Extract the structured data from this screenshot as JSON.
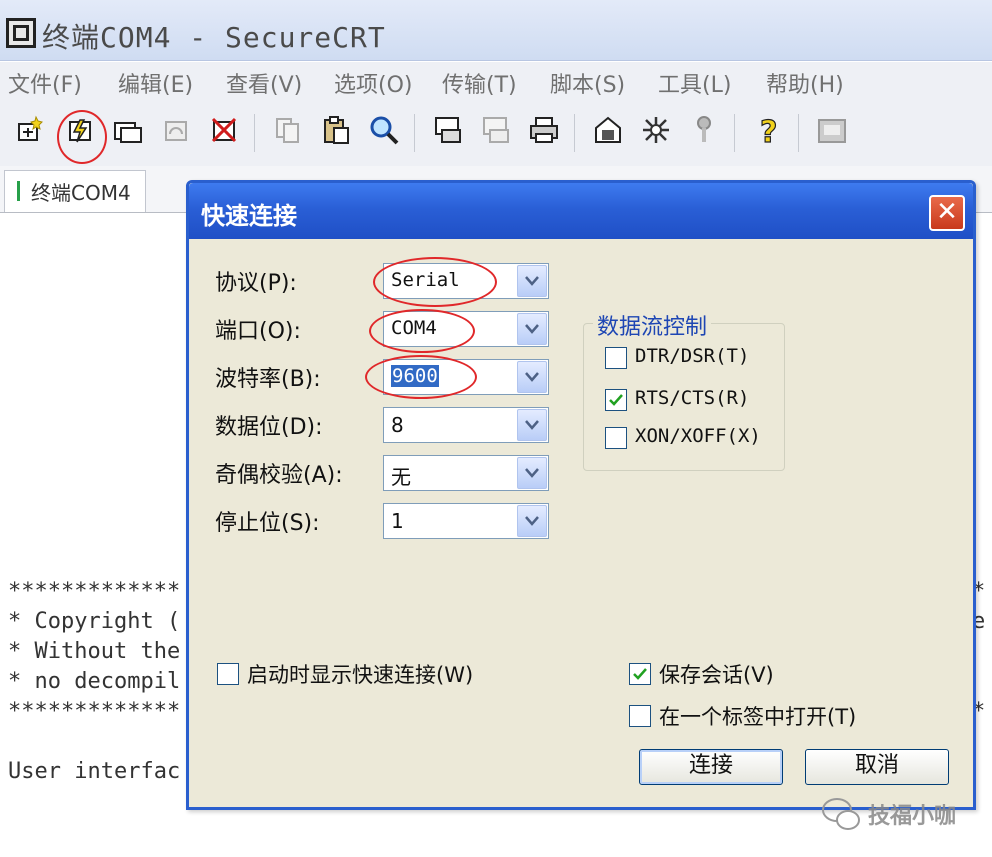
{
  "window": {
    "title": "终端COM4 - SecureCRT"
  },
  "menu": [
    {
      "label": "文件(F)"
    },
    {
      "label": "编辑(E)"
    },
    {
      "label": "查看(V)"
    },
    {
      "label": "选项(O)"
    },
    {
      "label": "传输(T)"
    },
    {
      "label": "脚本(S)"
    },
    {
      "label": "工具(L)"
    },
    {
      "label": "帮助(H)"
    }
  ],
  "toolbar": {
    "icons": [
      "connect-icon",
      "quick-connect-icon",
      "connect-in-tab-icon",
      "reconnect-icon",
      "disconnect-icon",
      "copy-icon",
      "paste-icon",
      "find-icon",
      "print-screen-icon",
      "print-selection-icon",
      "printer-icon",
      "session-options-icon",
      "global-options-icon",
      "key-icon",
      "help-icon",
      "keymap-icon"
    ]
  },
  "tab": {
    "label": "终端COM4"
  },
  "terminal": {
    "lines": [
      "*************",
      "* Copyright (",
      "* Without the",
      "* no decompil",
      "*************",
      "",
      "User interfac"
    ],
    "right_fragments": [
      "*",
      "e",
      "",
      "",
      "*"
    ]
  },
  "dialog": {
    "title": "快速连接",
    "close_label": "✕",
    "fields": {
      "protocol": {
        "label": "协议(P):",
        "value": "Serial"
      },
      "port": {
        "label": "端口(O):",
        "value": "COM4"
      },
      "baud": {
        "label": "波特率(B):",
        "value": "9600"
      },
      "data_bits": {
        "label": "数据位(D):",
        "value": "8"
      },
      "parity": {
        "label": "奇偶校验(A):",
        "value": "无"
      },
      "stop_bits": {
        "label": "停止位(S):",
        "value": "1"
      }
    },
    "flow_control": {
      "legend": "数据流控制",
      "options": [
        {
          "label": "DTR/DSR(T)",
          "checked": false
        },
        {
          "label": "RTS/CTS(R)",
          "checked": true
        },
        {
          "label": "XON/XOFF(X)",
          "checked": false
        }
      ]
    },
    "show_on_startup": {
      "label": "启动时显示快速连接(W)",
      "checked": false
    },
    "save_session": {
      "label": "保存会话(V)",
      "checked": true
    },
    "open_in_tab": {
      "label": "在一个标签中打开(T)",
      "checked": false
    },
    "buttons": {
      "connect": "连接",
      "cancel": "取消"
    }
  },
  "watermark": {
    "text": "技福小咖"
  },
  "colors": {
    "dialog_title": "#2a5fd6",
    "annotation": "#e0282a",
    "selection": "#316ac5"
  }
}
